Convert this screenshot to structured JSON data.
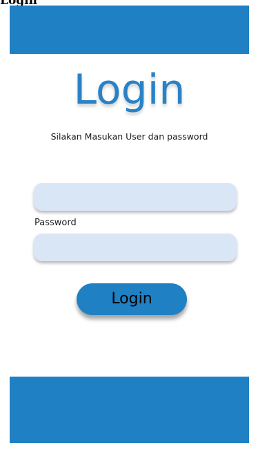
{
  "page": {
    "heading": "Login"
  },
  "screen": {
    "title": "Login",
    "subtitle": "Silakan Masukan User dan password",
    "username": {
      "value": "",
      "placeholder": ""
    },
    "password": {
      "label": "Password",
      "value": "",
      "placeholder": ""
    },
    "login_button_label": "Login"
  },
  "colors": {
    "primary": "#1f80c4",
    "title": "#2a82c6",
    "input_background": "#d9e6f6"
  }
}
